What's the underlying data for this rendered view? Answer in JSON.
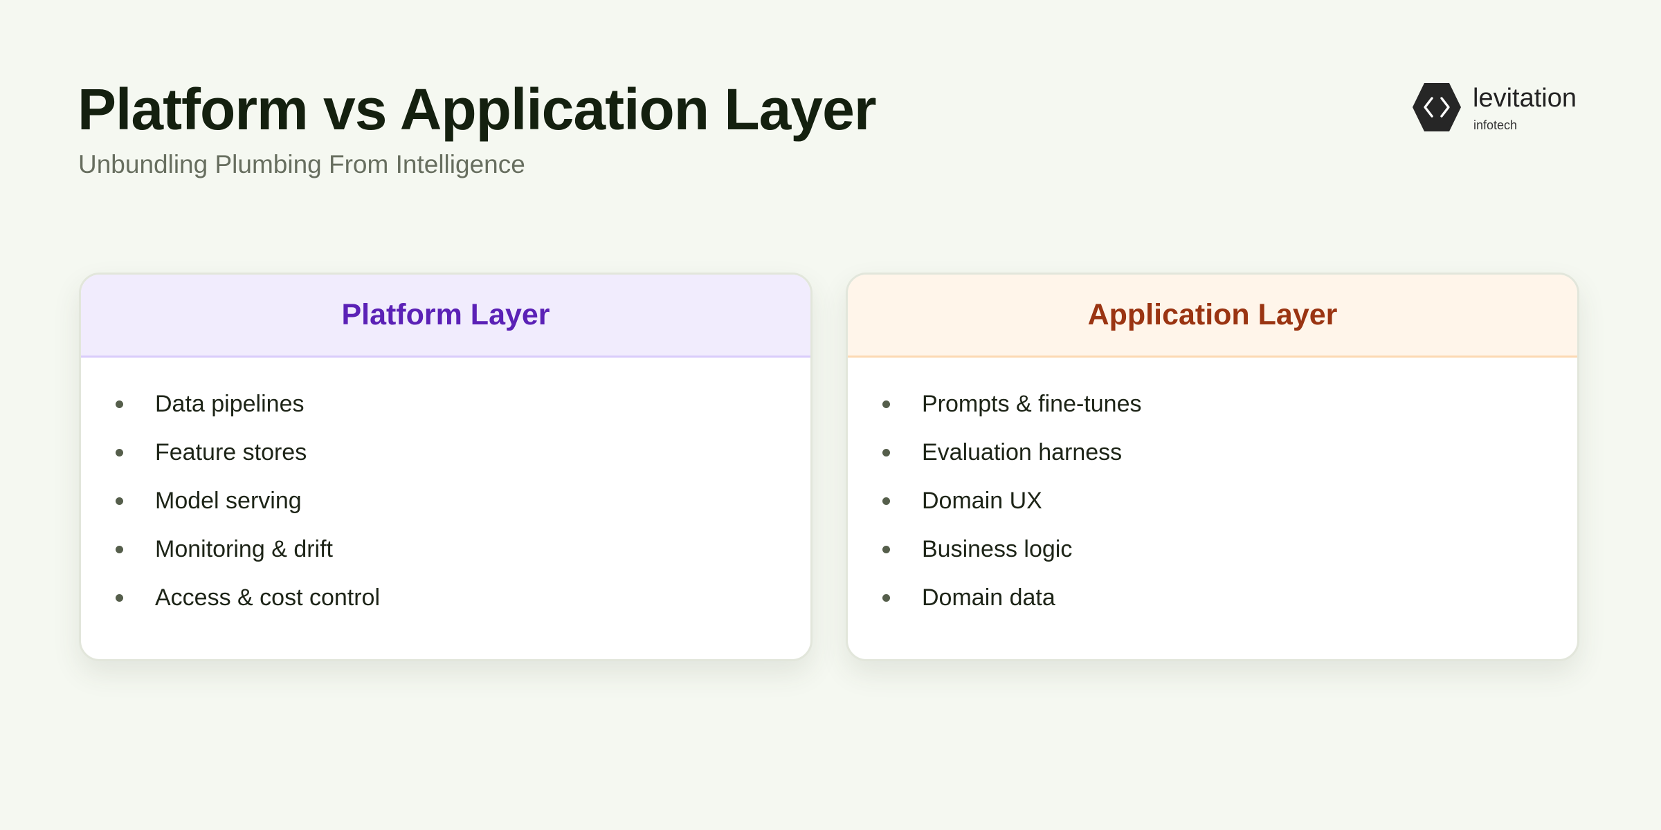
{
  "header": {
    "title": "Platform vs Application Layer",
    "subtitle": "Unbundling Plumbing From Intelligence"
  },
  "logo": {
    "icon": "hexagon-code-icon",
    "name": "levitation",
    "sub": "infotech"
  },
  "colors": {
    "background": "#f5f8f1",
    "platform_accent": "#5b21b6",
    "application_accent": "#9a3412"
  },
  "cards": [
    {
      "title": "Platform Layer",
      "items": [
        "Data pipelines",
        "Feature stores",
        "Model serving",
        "Monitoring & drift",
        "Access & cost control"
      ]
    },
    {
      "title": "Application Layer",
      "items": [
        "Prompts & fine-tunes",
        "Evaluation harness",
        "Domain UX",
        "Business logic",
        "Domain data"
      ]
    }
  ]
}
